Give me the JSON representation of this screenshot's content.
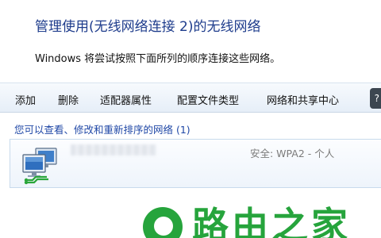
{
  "header": {
    "title": "管理使用(无线网络连接 2)的无线网络",
    "subtitle": "Windows 将尝试按照下面所列的顺序连接这些网络。"
  },
  "toolbar": {
    "items": [
      "添加",
      "删除",
      "适配器属性",
      "配置文件类型",
      "网络和共享中心"
    ],
    "help_icon": "help-icon"
  },
  "list": {
    "info": "您可以查看、修改和重新排序的网络 (1)",
    "networks": [
      {
        "name": "",
        "security": "安全: WPA2 - 个人",
        "icon": "wireless-network-icon"
      }
    ]
  },
  "watermark": {
    "text": "路由之家",
    "icon": "logo-icon",
    "color": "#26a43c"
  },
  "colors": {
    "title": "#1e3c8c",
    "link": "#1f47a6",
    "toolbar_bg": "#e6eef8"
  }
}
